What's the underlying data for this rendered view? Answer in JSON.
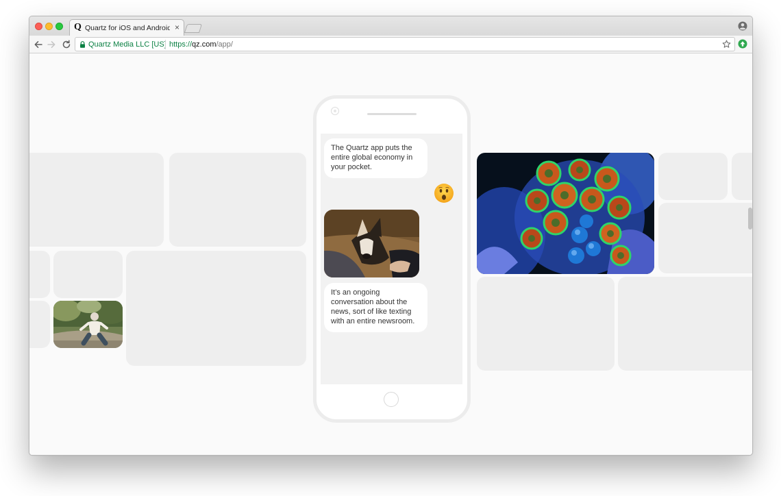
{
  "browser": {
    "tab": {
      "title": "Quartz for iOS and Android —",
      "favicon": "Q",
      "close": "×"
    },
    "omnibox": {
      "site_identity": "Quartz Media LLC [US]",
      "url_scheme": "https://",
      "url_host": "qz.com",
      "url_path": "/app/"
    },
    "icons": {
      "back": "arrow-left-icon",
      "forward": "arrow-right-icon",
      "reload": "reload-icon",
      "lock": "lock-icon",
      "bookmark": "star-icon",
      "extension": "extension-icon",
      "profile": "profile-icon"
    }
  },
  "phone": {
    "messages": [
      {
        "text": "The Quartz app puts the entire global economy in your pocket."
      },
      {
        "emoji": "hushed-face"
      },
      {
        "image": "dog-photo"
      },
      {
        "text": "It’s an ongoing conversation about the news, sort of like texting with an entire newsroom."
      }
    ]
  },
  "colors": {
    "secure_green": "#0b8043",
    "placeholder_tile": "#eeeeee",
    "page_background": "#fafafa"
  }
}
